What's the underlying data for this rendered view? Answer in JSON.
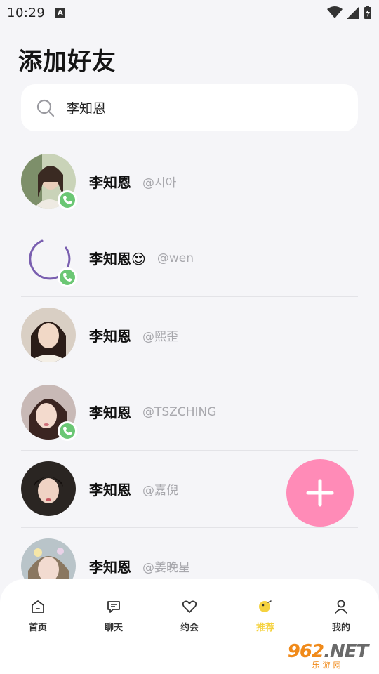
{
  "status_bar": {
    "time": "10:29",
    "badge": "A"
  },
  "page": {
    "title": "添加好友"
  },
  "search": {
    "value": "李知恩"
  },
  "contacts": [
    {
      "name": "李知恩",
      "handle": "@시아",
      "call": true,
      "avatar": "photo"
    },
    {
      "name": "李知恩😍",
      "handle": "@wen",
      "call": true,
      "avatar": "loading"
    },
    {
      "name": "李知恩",
      "handle": "@熙歪",
      "call": false,
      "avatar": "photo"
    },
    {
      "name": "李知恩",
      "handle": "@TSZCHING",
      "call": true,
      "avatar": "photo"
    },
    {
      "name": "李知恩",
      "handle": "@嘉倪",
      "call": false,
      "avatar": "photo"
    },
    {
      "name": "李知恩",
      "handle": "@姜晚星",
      "call": false,
      "avatar": "photo"
    }
  ],
  "tabs": [
    {
      "label": "首页",
      "icon": "home-icon"
    },
    {
      "label": "聊天",
      "icon": "chat-icon"
    },
    {
      "label": "约会",
      "icon": "heart-icon"
    },
    {
      "label": "推荐",
      "icon": "recommend-icon",
      "active": true
    },
    {
      "label": "我的",
      "icon": "profile-icon"
    }
  ],
  "watermark": {
    "main": "962",
    "net": ".NET",
    "sub": "乐游网"
  },
  "colors": {
    "accent_pink": "#ff8bb7",
    "call_green": "#6bc774",
    "active_yellow": "#f5d23f"
  }
}
